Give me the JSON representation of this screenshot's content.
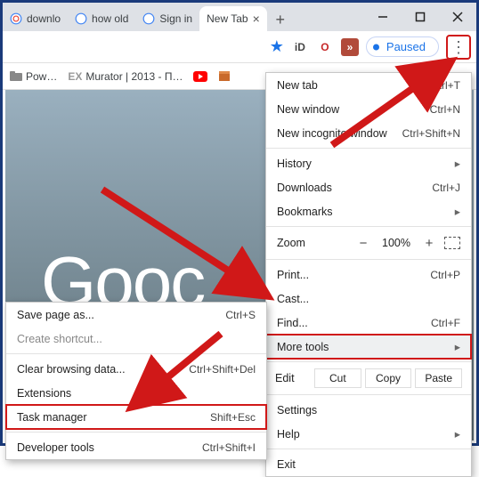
{
  "tabs": [
    {
      "label": "downlo",
      "icon": "google"
    },
    {
      "label": "how old",
      "icon": "google"
    },
    {
      "label": "Sign in",
      "icon": "google"
    },
    {
      "label": "New Tab",
      "active": true
    }
  ],
  "toolbar": {
    "paused_label": "Paused",
    "ext_icons": [
      "iD",
      "O",
      "»"
    ]
  },
  "bookmarks": [
    {
      "label": "Pow…",
      "icon": "folder"
    },
    {
      "label": "Murator | 2013 - П…",
      "prefix": "EX"
    },
    {
      "label": "",
      "icon": "yt"
    },
    {
      "label": "",
      "icon": "box"
    }
  ],
  "content": {
    "logo": "Gooc"
  },
  "main_menu": {
    "newtab": {
      "label": "New tab",
      "shortcut": "Ctrl+T"
    },
    "newwin": {
      "label": "New window",
      "shortcut": "Ctrl+N"
    },
    "incog": {
      "label": "New incognito window",
      "shortcut": "Ctrl+Shift+N"
    },
    "history": {
      "label": "History"
    },
    "downloads": {
      "label": "Downloads",
      "shortcut": "Ctrl+J"
    },
    "bookmarks": {
      "label": "Bookmarks"
    },
    "zoom": {
      "label": "Zoom",
      "minus": "−",
      "value": "100%",
      "plus": "+"
    },
    "print": {
      "label": "Print...",
      "shortcut": "Ctrl+P"
    },
    "cast": {
      "label": "Cast..."
    },
    "find": {
      "label": "Find...",
      "shortcut": "Ctrl+F"
    },
    "more": {
      "label": "More tools"
    },
    "edit": {
      "label": "Edit",
      "cut": "Cut",
      "copy": "Copy",
      "paste": "Paste"
    },
    "settings": {
      "label": "Settings"
    },
    "help": {
      "label": "Help"
    },
    "exit": {
      "label": "Exit"
    }
  },
  "sub_menu": {
    "save": {
      "label": "Save page as...",
      "shortcut": "Ctrl+S"
    },
    "shortcut": {
      "label": "Create shortcut..."
    },
    "clear": {
      "label": "Clear browsing data...",
      "shortcut": "Ctrl+Shift+Del"
    },
    "ext": {
      "label": "Extensions"
    },
    "task": {
      "label": "Task manager",
      "shortcut": "Shift+Esc"
    },
    "dev": {
      "label": "Developer tools",
      "shortcut": "Ctrl+Shift+I"
    }
  }
}
